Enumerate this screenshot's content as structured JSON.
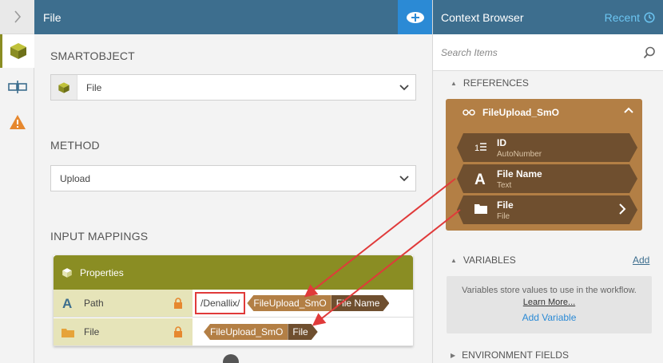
{
  "rail": {
    "items": [
      "smartobject-icon",
      "input-mapping-icon",
      "warning-icon"
    ]
  },
  "panel": {
    "title": "File",
    "smartobject_label": "SMARTOBJECT",
    "smartobject_value": "File",
    "method_label": "METHOD",
    "method_value": "Upload",
    "input_mappings_label": "INPUT MAPPINGS",
    "properties": {
      "title": "Properties",
      "rows": [
        {
          "name": "Path",
          "literal": "/Denallix/",
          "token_source": "FileUpload_SmO",
          "token_field": "File Name"
        },
        {
          "name": "File",
          "token_source": "FileUpload_SmO",
          "token_field": "File"
        }
      ]
    }
  },
  "browser": {
    "title": "Context Browser",
    "recent": "Recent",
    "search_placeholder": "Search Items",
    "references_label": "REFERENCES",
    "smartobject": "FileUpload_SmO",
    "fields": [
      {
        "name": "ID",
        "type": "AutoNumber"
      },
      {
        "name": "File Name",
        "type": "Text"
      },
      {
        "name": "File",
        "type": "File"
      }
    ],
    "variables_label": "VARIABLES",
    "variables_add": "Add",
    "variables_text": "Variables store values to use in the workflow.",
    "learn_more": "Learn More...",
    "add_variable": "Add Variable",
    "environment_label": "ENVIRONMENT FIELDS"
  },
  "colors": {
    "header": "#3d6e8e",
    "accent_blue": "#2b8ad5",
    "olive": "#8a8d23",
    "token_light": "#b37f45",
    "token_dark": "#6f4f2f",
    "annotation_red": "#e03a3a"
  }
}
